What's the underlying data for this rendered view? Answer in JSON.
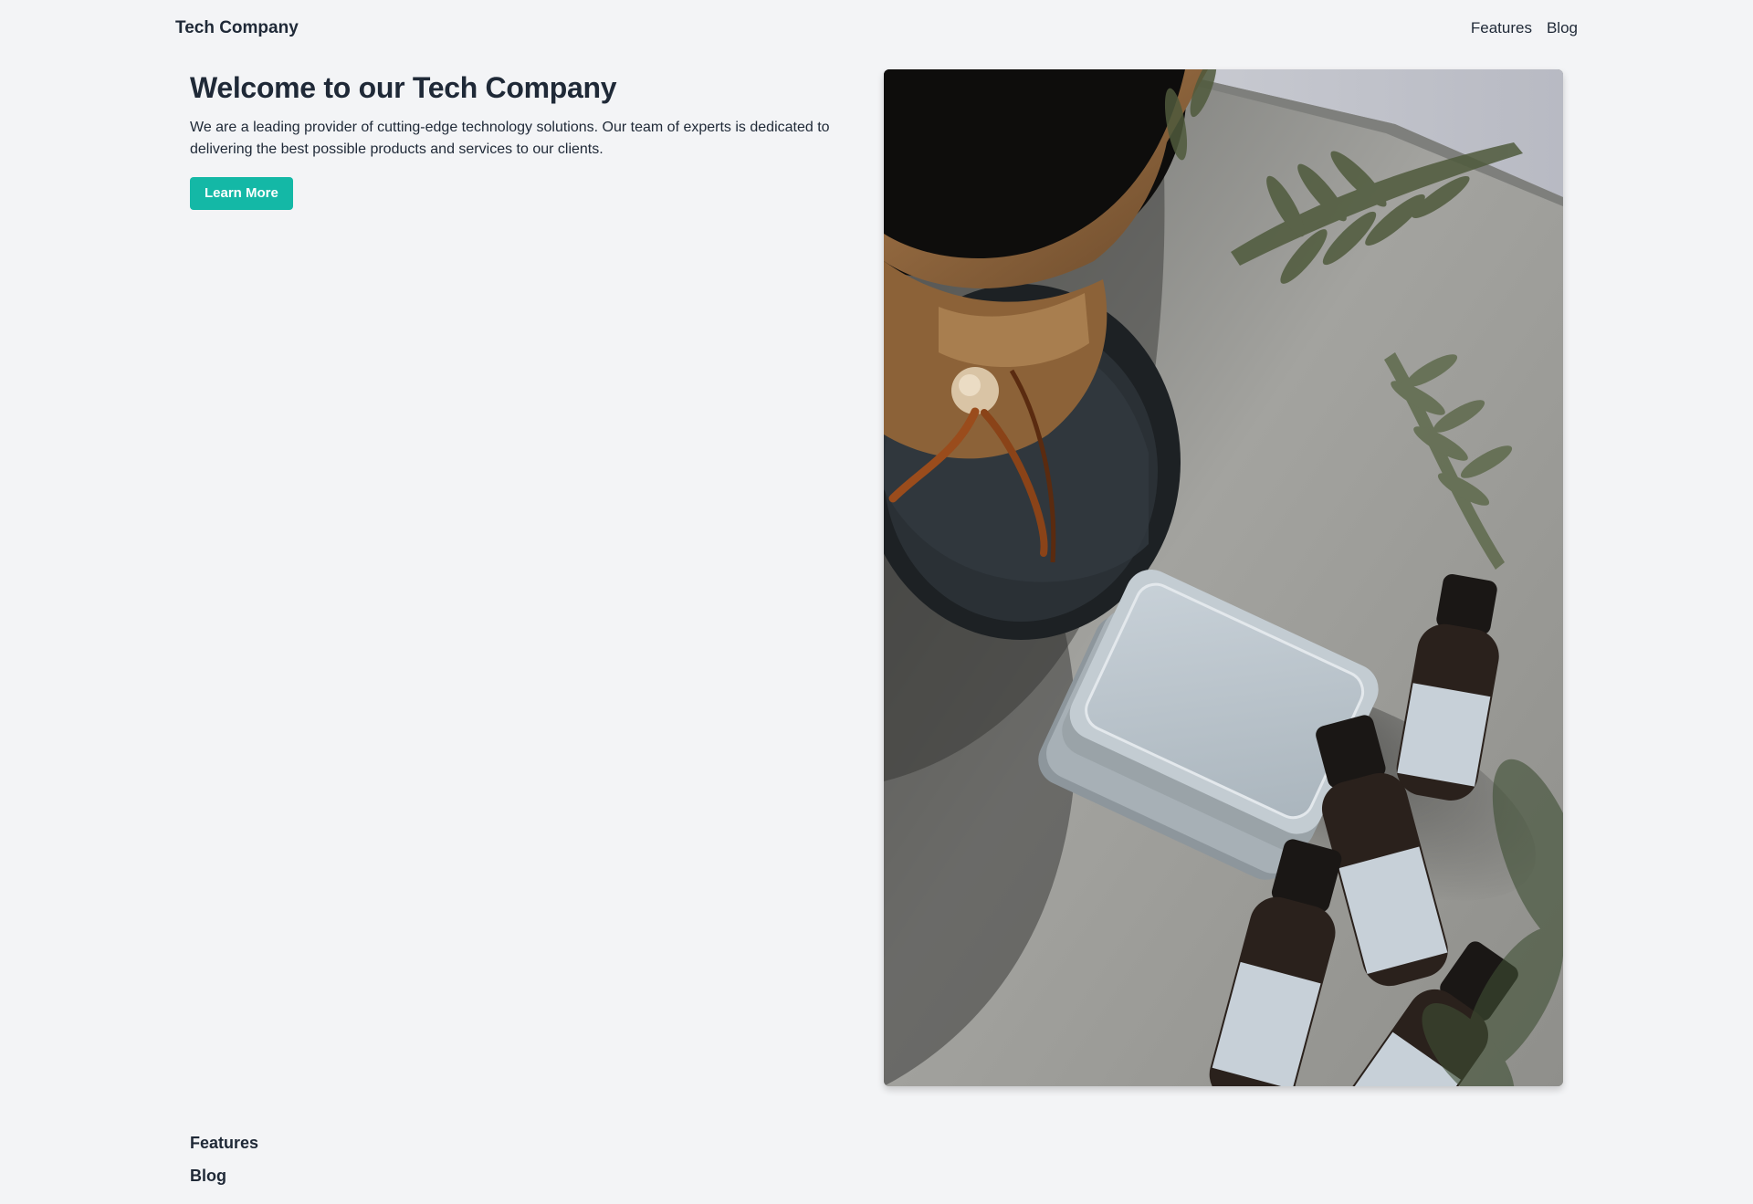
{
  "header": {
    "brand": "Tech Company",
    "nav": [
      {
        "label": "Features"
      },
      {
        "label": "Blog"
      }
    ]
  },
  "hero": {
    "title": "Welcome to our Tech Company",
    "description": "We are a leading provider of cutting-edge technology solutions. Our team of experts is dedicated to delivering the best possible products and services to our clients.",
    "cta_label": "Learn More",
    "image_subject": "coffee-pour-over-tins-and-dropper-bottles-photo"
  },
  "footer": {
    "links": [
      {
        "label": "Features"
      },
      {
        "label": "Blog"
      }
    ]
  },
  "colors": {
    "background": "#f3f4f6",
    "text": "#1f2937",
    "accent": "#14b8a6"
  }
}
